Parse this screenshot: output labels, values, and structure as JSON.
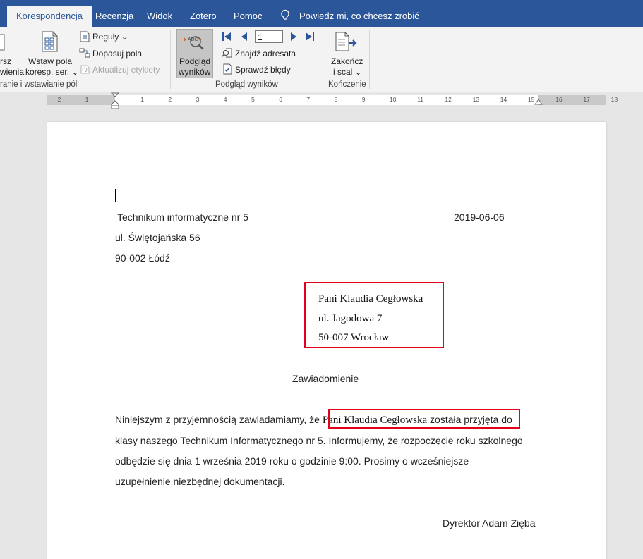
{
  "tabs": {
    "active": "Korespondencja",
    "items": [
      "Recenzja",
      "Widok",
      "Zotero",
      "Pomoc"
    ],
    "tell_me": "Powiedz mi, co chcesz zrobić"
  },
  "ribbon": {
    "partial_left_1": "rsz",
    "partial_left_2": "wienia",
    "insert_field_1": "Wstaw pola",
    "insert_field_2": "koresp. ser. ⌄",
    "rules": "Reguły ⌄",
    "match_fields": "Dopasuj pola",
    "update_labels": "Aktualizuj etykiety",
    "group_write": "ranie i wstawianie pól",
    "preview_1": "Podgląd",
    "preview_2": "wyników",
    "record_number": "1",
    "find_recipient": "Znajdź adresata",
    "check_errors": "Sprawdź błędy",
    "group_preview": "Podgląd wyników",
    "finish_1": "Zakończ",
    "finish_2": "i scal ⌄",
    "group_finish": "Kończenie"
  },
  "ruler": {
    "numbers": [
      "2",
      "1",
      "1",
      "2",
      "3",
      "4",
      "5",
      "6",
      "7",
      "8",
      "9",
      "10",
      "11",
      "12",
      "13",
      "14",
      "15",
      "16",
      "17",
      "18"
    ]
  },
  "document": {
    "sender_name": "Technikum informatyczne nr 5",
    "date": "2019-06-06",
    "sender_street": "ul. Świętojańska 56",
    "sender_city": "90-002 Łódź",
    "recipient_name": "Pani Klaudia Cegłowska",
    "recipient_street": "ul. Jagodowa 7",
    "recipient_city": "50-007 Wrocław",
    "subject": "Zawiadomienie",
    "body_start": "Niniejszym z przyjemnością zawiadamiamy, że ",
    "body_merge_name": "Pani Klaudia Cegłowska",
    "body_merge_rest": " została przyjęta",
    "body_end": " do",
    "body_line2": "klasy naszego Technikum Informatycznego nr 5. Informujemy, że rozpoczęcie roku szkolnego",
    "body_line3": "odbędzie się dnia 1 września 2019 roku o godzinie 9:00. Prosimy o wcześniejsze",
    "body_line4": "uzupełnienie niezbędnej dokumentacji.",
    "signature": "Dyrektor Adam Zięba"
  },
  "colors": {
    "tab_bar": "#2b579a",
    "highlight_box": "#e3001b"
  }
}
